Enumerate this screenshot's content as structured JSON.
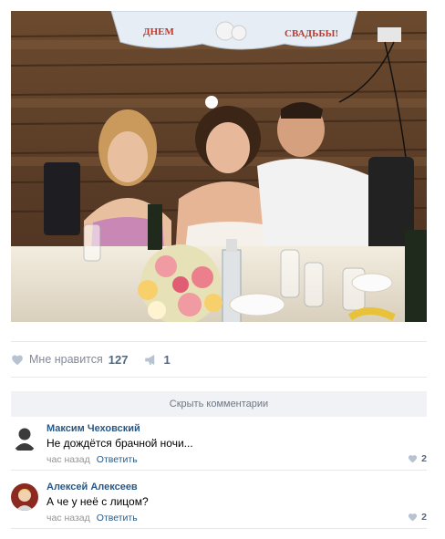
{
  "post": {
    "photo": {
      "banner_left": "ДНЕМ",
      "banner_right": "СВАДЬБЫ!"
    },
    "likes": {
      "icon": "heart-icon",
      "label": "Мне нравится",
      "count": "127"
    },
    "shares": {
      "icon": "megaphone-icon",
      "count": "1"
    }
  },
  "comments_section": {
    "hide_label": "Скрыть комментарии",
    "items": [
      {
        "author": "Максим Чеховский",
        "text": "Не дождётся брачной ночи...",
        "time": "час назад",
        "reply_label": "Ответить",
        "likes": "2",
        "avatar": "default-avatar"
      },
      {
        "author": "Алексей Алексеев",
        "text": "А че у неё с лицом?",
        "time": "час назад",
        "reply_label": "Ответить",
        "likes": "2",
        "avatar": "photo-avatar"
      }
    ]
  },
  "colors": {
    "link": "#2a5885",
    "muted": "#828a99",
    "divider": "#e7e8ec",
    "button_bg": "#f0f2f5"
  }
}
